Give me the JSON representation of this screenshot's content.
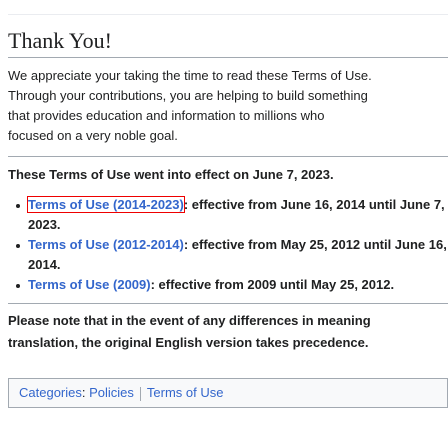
{
  "heading": "Thank You!",
  "intro_lines": [
    "We appreciate your taking the time to read these Terms of Use.",
    "Through your contributions, you are helping to build something",
    "that provides education and information to millions who",
    "focused on a very noble goal."
  ],
  "effective_note": "These Terms of Use went into effect on June 7, 2023.",
  "versions": [
    {
      "link": "Terms of Use (2014-2023)",
      "text": ": effective from June 16, 2014 until June 7, 2023."
    },
    {
      "link": "Terms of Use (2012-2014)",
      "text": ": effective from May 25, 2012 until June 16, 2014."
    },
    {
      "link": "Terms of Use (2009)",
      "text": ": effective from 2009 until May 25, 2012."
    }
  ],
  "note_lines": [
    "Please note that in the event of any differences in meaning",
    "translation, the original English version takes precedence."
  ],
  "categories": {
    "label": "Categories",
    "items": [
      "Policies",
      "Terms of Use"
    ]
  }
}
